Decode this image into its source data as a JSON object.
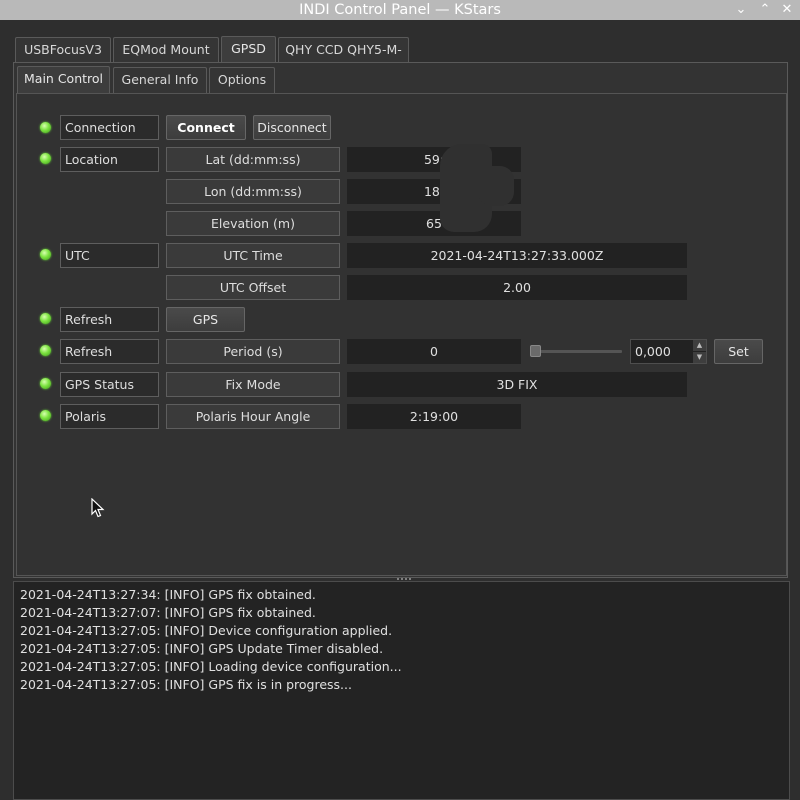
{
  "window": {
    "title": "INDI Control Panel — KStars",
    "buttons": {
      "dropdown": "⌄",
      "minimize": "⌃",
      "close": "✕"
    }
  },
  "device_tabs": [
    "USBFocusV3",
    "EQMod Mount",
    "GPSD",
    "QHY CCD QHY5-M-"
  ],
  "active_device": "GPSD",
  "group_tabs": [
    "Main Control",
    "General Info",
    "Options"
  ],
  "active_group": "Main Control",
  "properties": {
    "connection": {
      "label": "Connection",
      "connect": "Connect",
      "disconnect": "Disconnect"
    },
    "location": {
      "label": "Location",
      "lat_label": "Lat (dd:mm:ss)",
      "lat_value": "59:",
      "lon_label": "Lon (dd:mm:ss)",
      "lon_value": "18:",
      "elev_label": "Elevation (m)",
      "elev_value": "65"
    },
    "utc": {
      "label": "UTC",
      "time_label": "UTC Time",
      "time_value": "2021-04-24T13:27:33.000Z",
      "offset_label": "UTC Offset",
      "offset_value": "2.00"
    },
    "refresh_gps": {
      "label": "Refresh",
      "button": "GPS"
    },
    "refresh_period": {
      "label": "Refresh",
      "period_label": "Period (s)",
      "period_value": "0",
      "spin_value": "0,000",
      "set_button": "Set",
      "slider_level": 0
    },
    "gps_status": {
      "label": "GPS Status",
      "fix_label": "Fix Mode",
      "fix_value": "3D FIX"
    },
    "polaris": {
      "label": "Polaris",
      "hour_angle_label": "Polaris Hour Angle",
      "hour_angle_value": "2:19:00"
    }
  },
  "log": [
    "2021-04-24T13:27:34: [INFO] GPS fix obtained.",
    "2021-04-24T13:27:07: [INFO] GPS fix obtained.",
    "2021-04-24T13:27:05: [INFO] Device configuration applied.",
    "2021-04-24T13:27:05: [INFO] GPS Update Timer disabled.",
    "2021-04-24T13:27:05: [INFO] Loading device configuration...",
    "2021-04-24T13:27:05: [INFO] GPS fix is in progress..."
  ],
  "colors": {
    "led_ok": "#7ce340",
    "title_bar": "#b9b9b9",
    "panel_bg": "#2e2e2e"
  }
}
